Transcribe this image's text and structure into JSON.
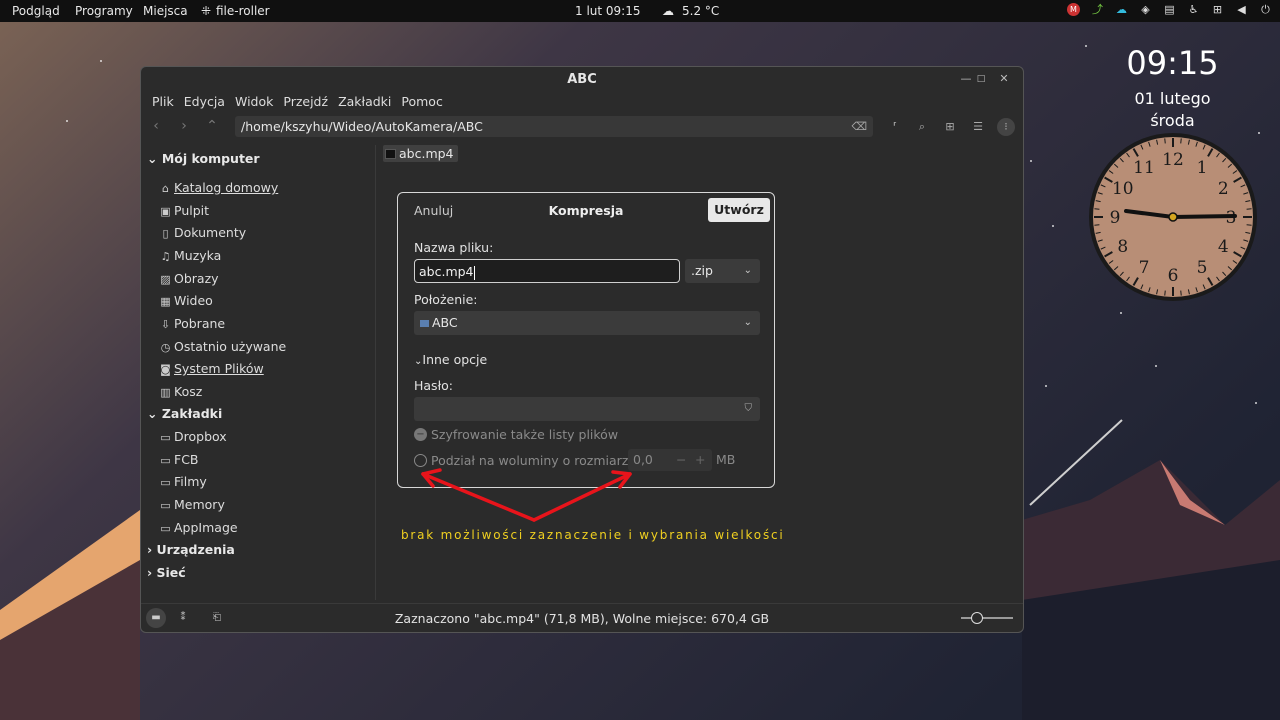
{
  "topbar": {
    "menu": [
      "Podgląd",
      "Programy",
      "Miejsca"
    ],
    "app_name": "file-roller",
    "datetime": "1 lut  09:15",
    "weather": "5.2 °C"
  },
  "clock_widget": {
    "time": "09:15",
    "date_line": "01 lutego",
    "day_line": "środa",
    "numerals": [
      "12",
      "1",
      "2",
      "3",
      "4",
      "5",
      "6",
      "7",
      "8",
      "9",
      "10",
      "11"
    ]
  },
  "window": {
    "title": "ABC",
    "menu": [
      "Plik",
      "Edycja",
      "Widok",
      "Przejdź",
      "Zakładki",
      "Pomoc"
    ],
    "path": "/home/kszyhu/Wideo/AutoKamera/ABC",
    "sidebar": {
      "my_computer": "Mój komputer",
      "computer_items": [
        {
          "label": "Katalog domowy",
          "icon": "home-icon"
        },
        {
          "label": "Pulpit",
          "icon": "desktop-icon"
        },
        {
          "label": "Dokumenty",
          "icon": "document-icon"
        },
        {
          "label": "Muzyka",
          "icon": "music-icon"
        },
        {
          "label": "Obrazy",
          "icon": "image-icon"
        },
        {
          "label": "Wideo",
          "icon": "video-icon"
        },
        {
          "label": "Pobrane",
          "icon": "download-icon"
        },
        {
          "label": "Ostatnio używane",
          "icon": "recent-icon"
        },
        {
          "label": "System Plików",
          "icon": "drive-icon"
        },
        {
          "label": "Kosz",
          "icon": "trash-icon"
        }
      ],
      "bookmarks": "Zakładki",
      "bookmark_items": [
        "Dropbox",
        "FCB",
        "Filmy",
        "Memory",
        "AppImage"
      ],
      "devices": "Urządzenia",
      "network": "Sieć"
    },
    "file_name": "abc.mp4",
    "status": "Zaznaczono \"abc.mp4\" (71,8 MB), Wolne miejsce: 670,4 GB"
  },
  "dialog": {
    "cancel": "Anuluj",
    "title": "Kompresja",
    "create": "Utwórz",
    "filename_label": "Nazwa pliku:",
    "filename_value": "abc.mp4",
    "extension": ".zip",
    "location_label": "Położenie:",
    "location_value": "ABC",
    "more_options": "Inne opcje",
    "password_label": "Hasło:",
    "encrypt_list": "Szyfrowanie także listy plików",
    "split_label": "Podział na woluminy o rozmiarze",
    "split_value": "0,0",
    "split_unit": "MB"
  },
  "annotation": "brak możliwości zaznaczenie i wybrania wielkości",
  "colors": {
    "annotation_text": "#f0d020",
    "arrow": "#e8141b"
  }
}
